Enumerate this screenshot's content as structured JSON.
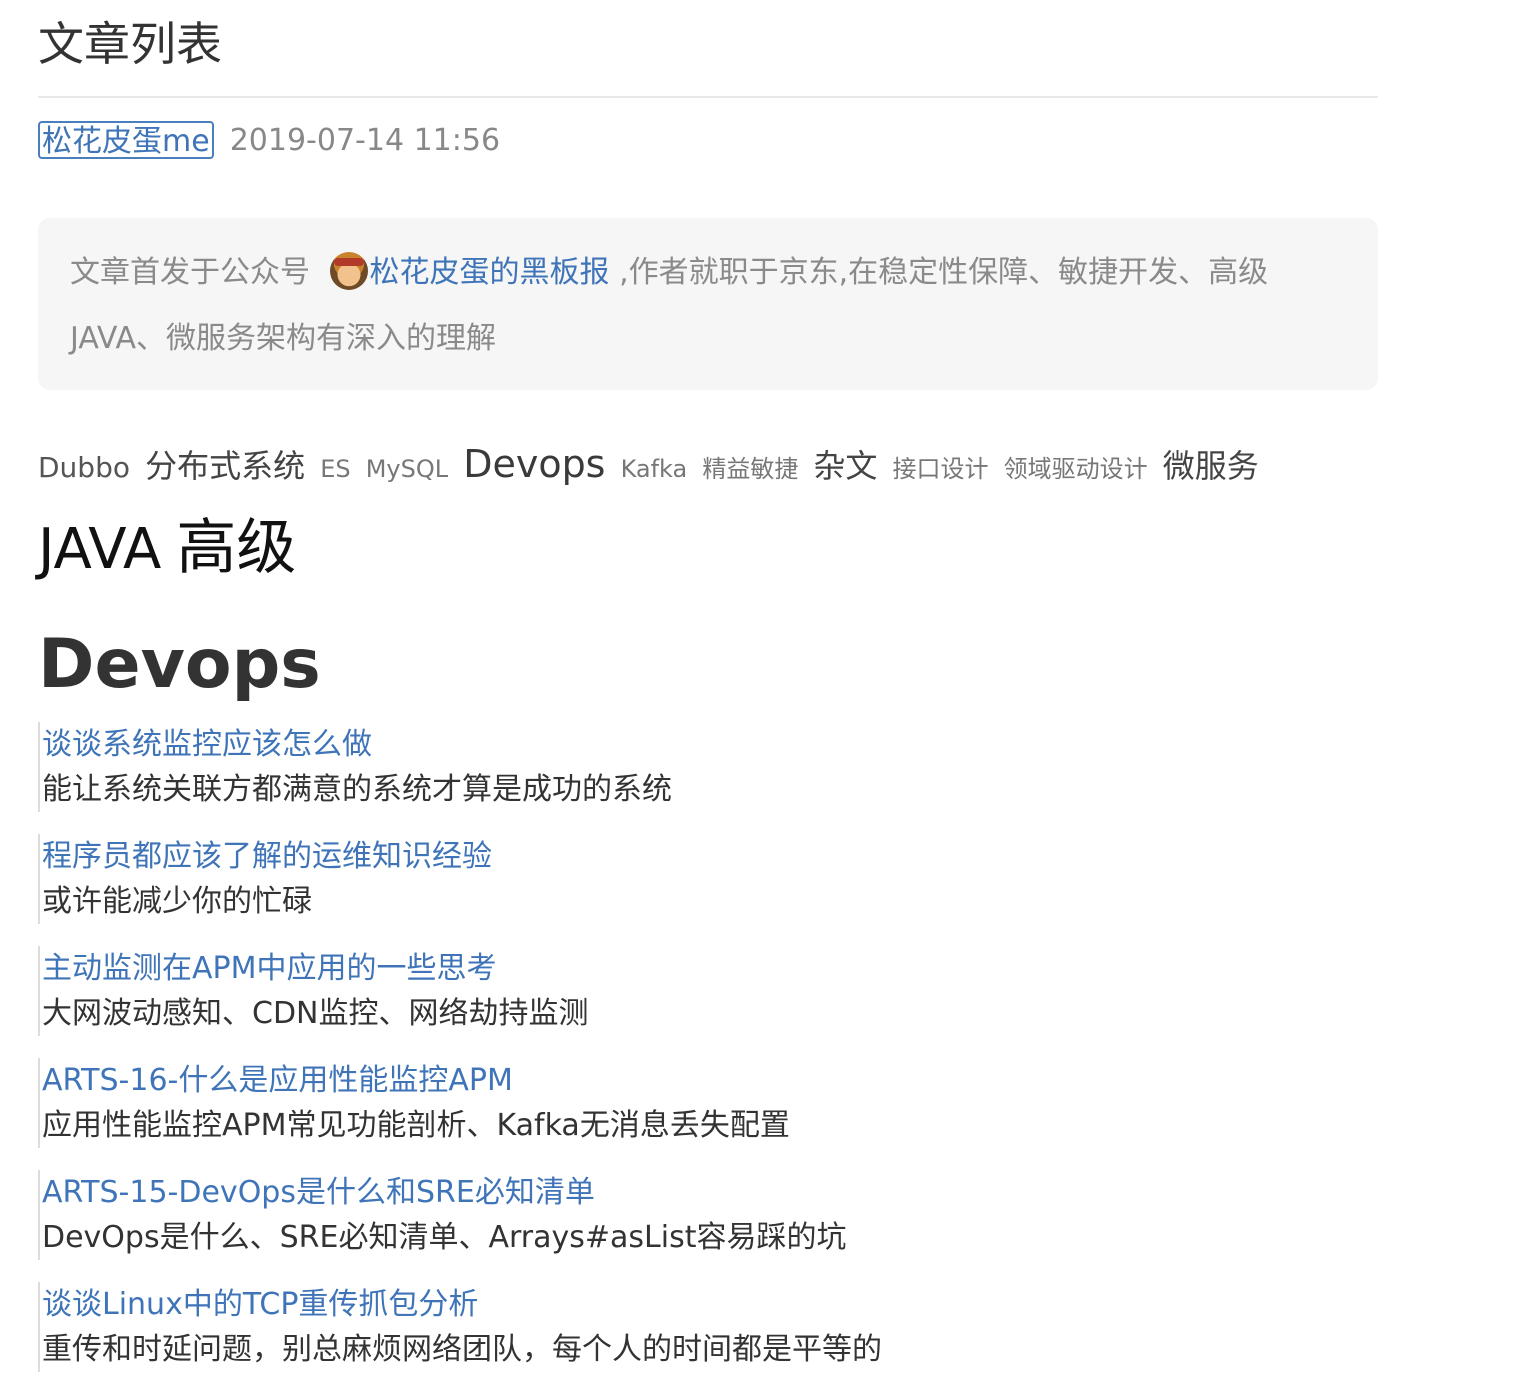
{
  "page": {
    "title": "文章列表"
  },
  "meta": {
    "author": "松花皮蛋me",
    "date": "2019-07-14 11:56"
  },
  "notice": {
    "prefix": "文章首发于公众号 ",
    "avatar_icon": "cartoon-avatar-icon",
    "account": "松花皮蛋的黑板报",
    "suffix": " ,作者就职于京东,在稳定性保障、敏捷开发、高级JAVA、微服务架构有深入的理解"
  },
  "tags": [
    {
      "label": "Dubbo",
      "size": 2
    },
    {
      "label": "分布式系统",
      "size": 3
    },
    {
      "label": "ES",
      "size": 1
    },
    {
      "label": "MySQL",
      "size": 1
    },
    {
      "label": "Devops",
      "size": 4
    },
    {
      "label": "Kafka",
      "size": 1
    },
    {
      "label": "精益敏捷",
      "size": 1
    },
    {
      "label": "杂文",
      "size": 3
    },
    {
      "label": "接口设计",
      "size": 1
    },
    {
      "label": "领域驱动设计",
      "size": 1
    },
    {
      "label": "微服务",
      "size": 3
    },
    {
      "label": "JAVA",
      "size": 5
    },
    {
      "label": "高级",
      "size": 6
    }
  ],
  "section": {
    "title": "Devops"
  },
  "articles": [
    {
      "title": "谈谈系统监控应该怎么做",
      "desc": "能让系统关联方都满意的系统才算是成功的系统"
    },
    {
      "title": "程序员都应该了解的运维知识经验",
      "desc": "或许能减少你的忙碌"
    },
    {
      "title": "主动监测在APM中应用的一些思考",
      "desc": "大网波动感知、CDN监控、网络劫持监测"
    },
    {
      "title": "ARTS-16-什么是应用性能监控APM",
      "desc": "应用性能监控APM常见功能剖析、Kafka无消息丢失配置"
    },
    {
      "title": "ARTS-15-DevOps是什么和SRE必知清单",
      "desc": "DevOps是什么、SRE必知清单、Arrays#asList容易踩的坑"
    },
    {
      "title": "谈谈Linux中的TCP重传抓包分析",
      "desc": "重传和时延问题，别总麻烦网络团队，每个人的时间都是平等的"
    }
  ],
  "colors": {
    "link": "#3f75b8",
    "muted": "#888888",
    "text": "#333333",
    "notice_bg": "#f6f6f6"
  }
}
